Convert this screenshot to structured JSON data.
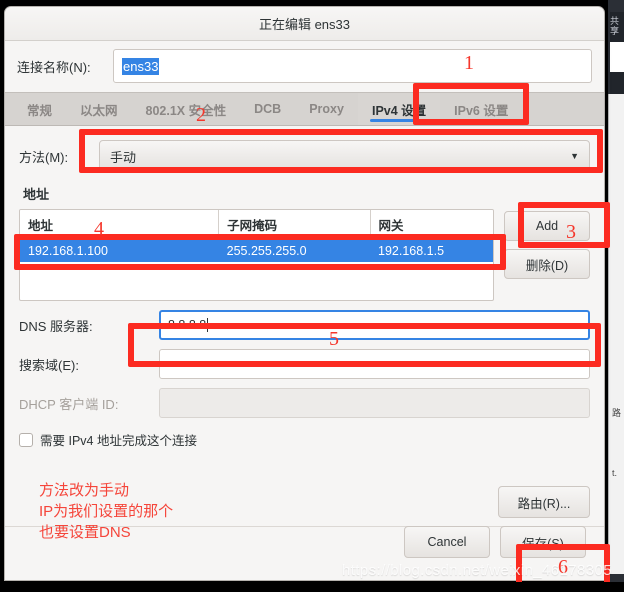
{
  "window": {
    "title": "正在编辑 ens33"
  },
  "connection": {
    "label": "连接名称(N):",
    "value": "ens33"
  },
  "tabs": [
    {
      "label": "常规",
      "active": false
    },
    {
      "label": "以太网",
      "active": false
    },
    {
      "label": "802.1X 安全性",
      "active": false
    },
    {
      "label": "DCB",
      "active": false
    },
    {
      "label": "Proxy",
      "active": false
    },
    {
      "label": "IPv4 设置",
      "active": true
    },
    {
      "label": "IPv6 设置",
      "active": false
    }
  ],
  "method": {
    "label": "方法(M):",
    "value": "手动",
    "arrow_icon": "chevron-down-icon"
  },
  "addresses": {
    "section_title": "地址",
    "columns": [
      "地址",
      "子网掩码",
      "网关"
    ],
    "rows": [
      {
        "address": "192.168.1.100",
        "netmask": "255.255.255.0",
        "gateway": "192.168.1.5",
        "selected": true
      }
    ],
    "add_label": "Add",
    "delete_label": "删除(D)"
  },
  "fields": {
    "dns_label": "DNS 服务器:",
    "dns_value": "8.8.8.8",
    "search_label": "搜索域(E):",
    "search_value": "",
    "dhcp_label": "DHCP 客户端 ID:",
    "dhcp_value": "",
    "checkbox_label": "需要 IPv4 地址完成这个连接"
  },
  "buttons": {
    "routes": "路由(R)...",
    "cancel": "Cancel",
    "save": "保存(S)"
  },
  "annotations": {
    "numbers": [
      "1",
      "2",
      "3",
      "4",
      "5",
      "6"
    ],
    "note": "方法改为手动\nIP为我们设置的那个\n也要设置DNS",
    "watermark": "https://blog.csdn.net/weixin_46178305"
  },
  "colors": {
    "annotation_red": "#fc2b21",
    "selection_blue": "#3584e4",
    "accent_underline": "#3584e4"
  },
  "background_window": {
    "vertical_text": "共享"
  }
}
